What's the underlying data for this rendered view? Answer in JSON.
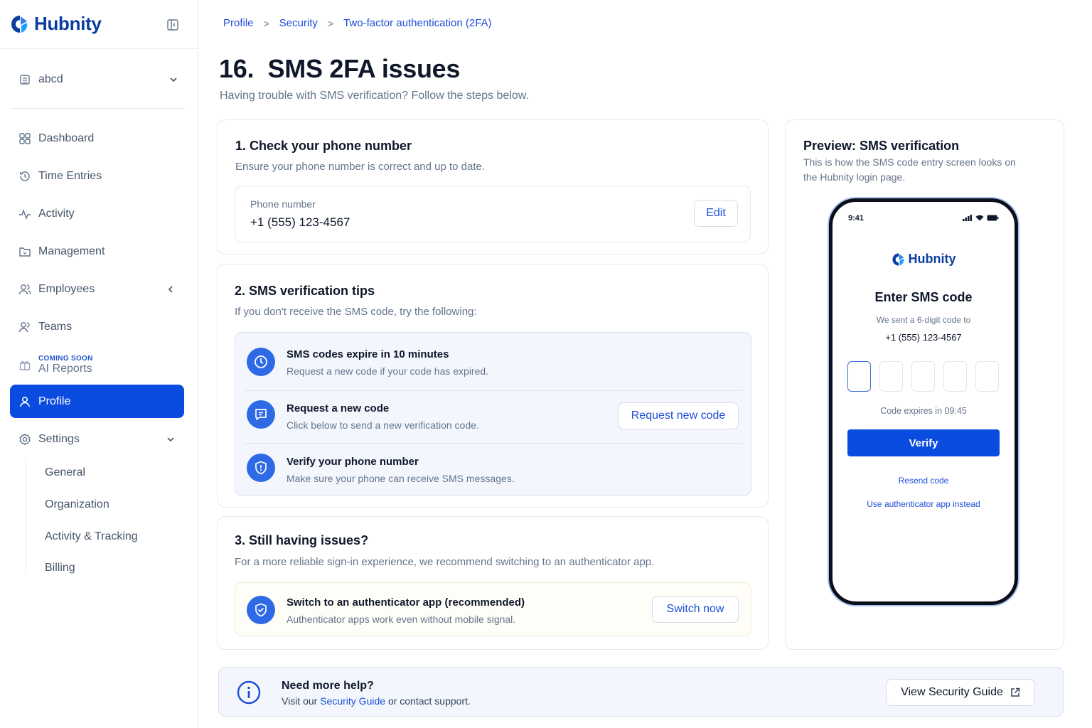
{
  "brand": {
    "name": "Hubnity"
  },
  "workspace": {
    "name": "abcd"
  },
  "nav": {
    "dashboard": "Dashboard",
    "time_entries": "Time Entries",
    "activity": "Activity",
    "management": "Management",
    "employees": "Employees",
    "teams": "Teams",
    "ai_reports_badge": "COMING SOON",
    "ai_reports": "AI Reports",
    "profile": "Profile",
    "settings": "Settings",
    "settings_sub": [
      "General",
      "Organization",
      "Activity & Tracking",
      "Billing"
    ]
  },
  "breadcrumb": [
    "Profile",
    "Security",
    "Two-factor authentication (2FA)"
  ],
  "page": {
    "title": "16.  SMS 2FA issues",
    "subtitle": "Having trouble with SMS verification? Follow the steps below."
  },
  "step1": {
    "title": "1. Check your phone number",
    "desc": "Ensure your phone number is correct and up to date.",
    "field_label": "Phone number",
    "field_value": "+1 (555) 123-4567",
    "edit_label": "Edit"
  },
  "step2": {
    "title": "2. SMS verification tips",
    "desc": "If you don't receive the SMS code, try the following:",
    "tips": [
      {
        "title": "SMS codes expire in 10 minutes",
        "desc": "Request a new code if your code has expired.",
        "icon": "clock-icon"
      },
      {
        "title": "Request a new code",
        "desc": "Click below to send a new verification code.",
        "icon": "message-icon"
      },
      {
        "title": "Verify your phone number",
        "desc": "Make sure your phone can receive SMS messages.",
        "icon": "shield-icon"
      }
    ],
    "request_label": "Request new code"
  },
  "step3": {
    "title": "3. Still having issues?",
    "desc": "For a more reliable sign-in experience, we recommend switching to an authenticator app.",
    "auth_title": "Switch to an authenticator app (recommended)",
    "auth_desc": "Authenticator apps work even without mobile signal.",
    "switch_label": "Switch now"
  },
  "preview": {
    "title": "Preview: SMS verification",
    "desc": "This is how the SMS code entry screen looks on the Hubnity login page.",
    "phone": {
      "time": "9:41",
      "brand": "Hubnity",
      "heading": "Enter SMS code",
      "sent_text": "We sent a 6-digit code to",
      "number": "+1 (555) 123-4567",
      "expires": "Code expires in 09:45",
      "verify_label": "Verify",
      "resend_label": "Resend code",
      "alt_label": "Use authenticator app instead"
    }
  },
  "help": {
    "title": "Need more help?",
    "desc_prefix": "Visit our",
    "desc_link": "Security Guide",
    "desc_suffix": "or contact support.",
    "guide_label": "View Security Guide"
  },
  "colors": {
    "primary": "#0b4ce0",
    "brand": "#0b3d9e",
    "link": "#1d4ed8"
  }
}
